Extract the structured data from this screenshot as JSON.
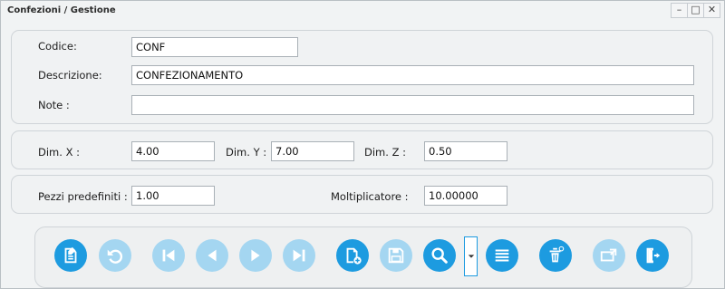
{
  "window": {
    "title": "Confezioni / Gestione",
    "minimize": "–",
    "maximize": "□",
    "close": "✕"
  },
  "form": {
    "codice": {
      "label": "Codice:",
      "value": "CONF"
    },
    "descrizione": {
      "label": "Descrizione:",
      "value": "CONFEZIONAMENTO"
    },
    "note": {
      "label": "Note :",
      "value": ""
    }
  },
  "dimensions": {
    "x": {
      "label": "Dim. X :",
      "value": "4.00"
    },
    "y": {
      "label": "Dim. Y :",
      "value": "7.00"
    },
    "z": {
      "label": "Dim. Z :",
      "value": "0.50"
    }
  },
  "extra": {
    "pezzi": {
      "label": "Pezzi predefiniti :",
      "value": "1.00"
    },
    "moltiplicatore": {
      "label": "Moltiplicatore :",
      "value": "10.00000"
    }
  },
  "toolbar": {
    "accent": "#1d9be0",
    "disabled": "#a4d6f1",
    "buttons": [
      {
        "icon": "edit-document-icon",
        "enabled": true
      },
      {
        "icon": "undo-icon",
        "enabled": false
      },
      {
        "icon": "first-record-icon",
        "enabled": false
      },
      {
        "icon": "previous-record-icon",
        "enabled": false
      },
      {
        "icon": "next-record-icon",
        "enabled": false
      },
      {
        "icon": "last-record-icon",
        "enabled": false
      },
      {
        "icon": "new-document-icon",
        "enabled": true
      },
      {
        "icon": "save-icon",
        "enabled": false
      },
      {
        "icon": "search-icon",
        "enabled": true
      },
      {
        "icon": "dropdown-arrow-icon",
        "enabled": true
      },
      {
        "icon": "list-icon",
        "enabled": true
      },
      {
        "icon": "delete-icon",
        "enabled": true
      },
      {
        "icon": "print-export-icon",
        "enabled": false
      },
      {
        "icon": "exit-icon",
        "enabled": true
      }
    ]
  }
}
